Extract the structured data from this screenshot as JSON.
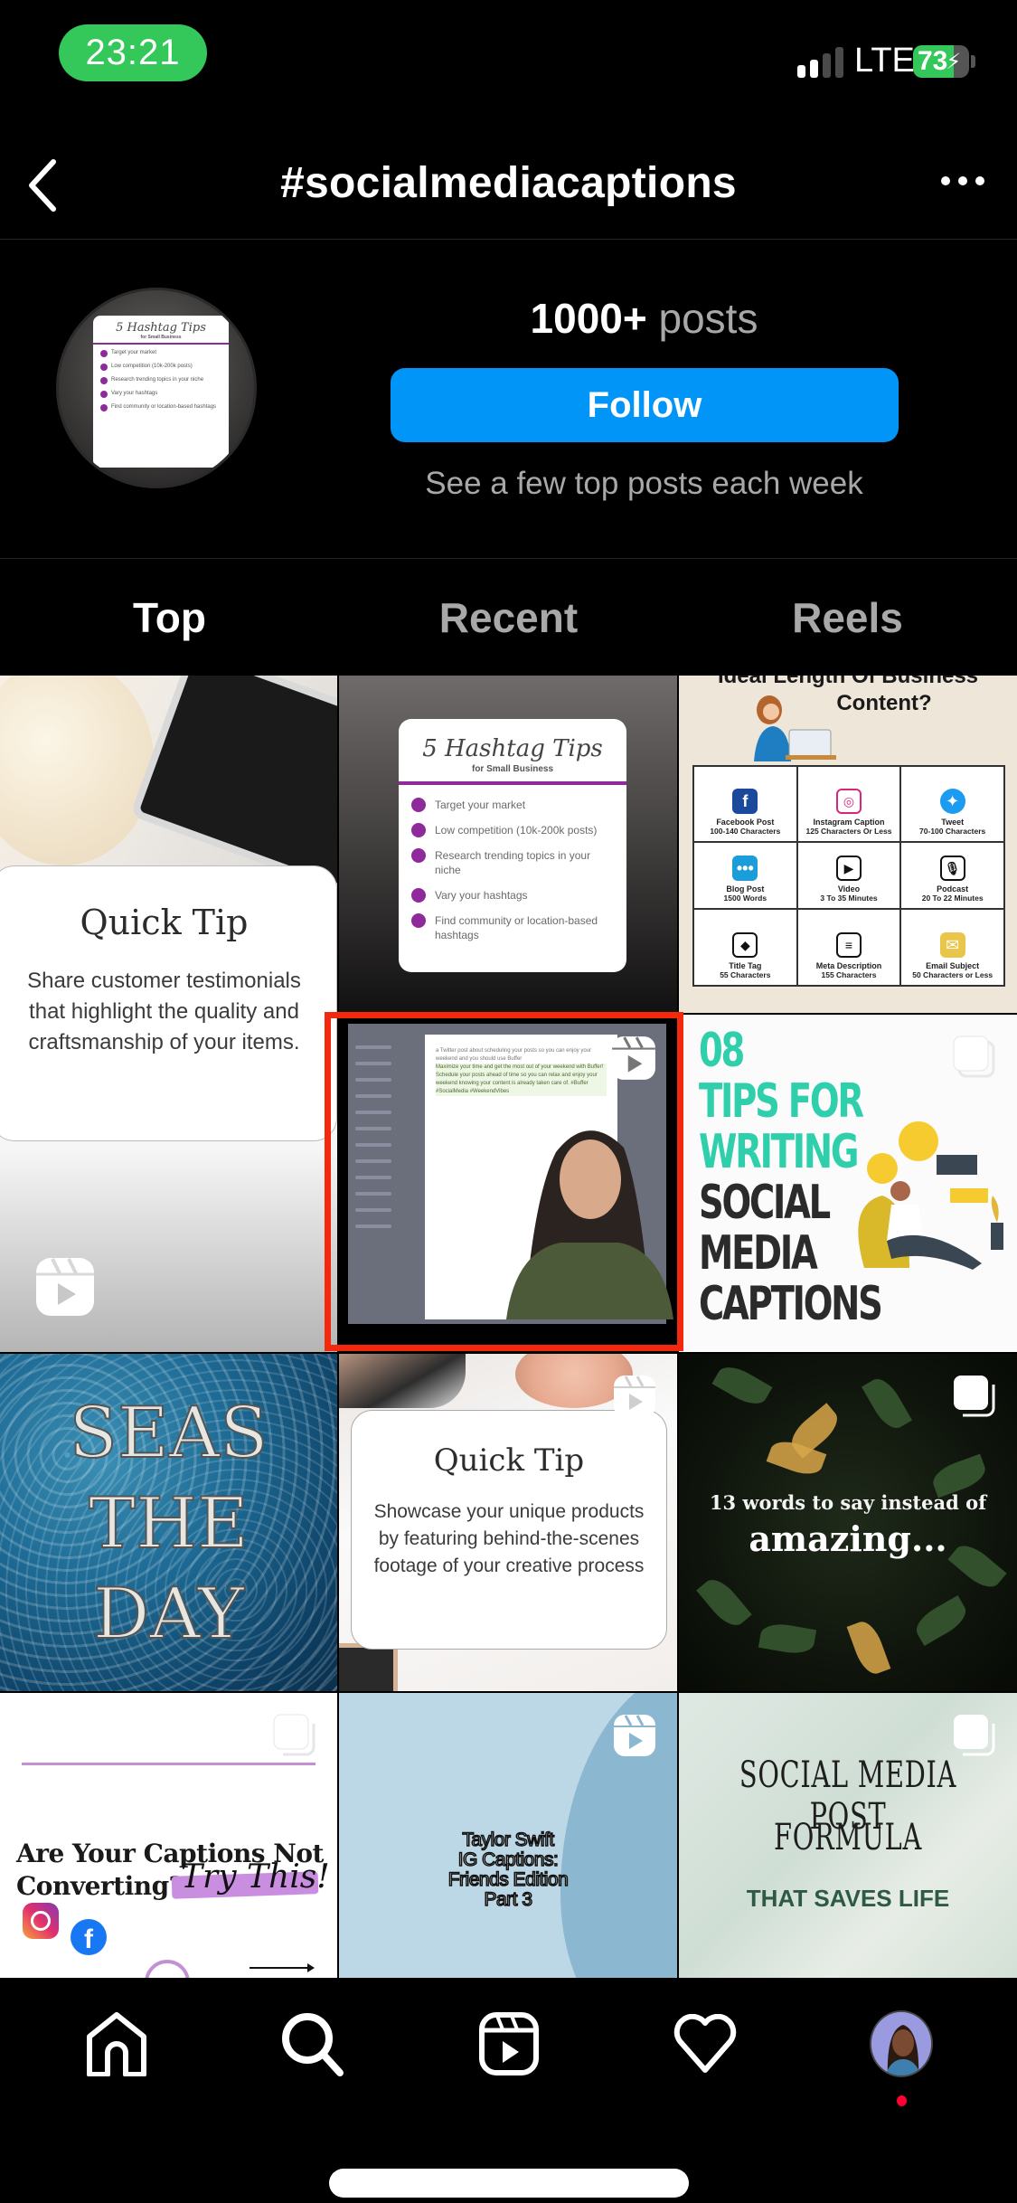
{
  "status_bar": {
    "time": "23:21",
    "network": "LTE",
    "battery_level": "73",
    "battery_percent": 73,
    "charging": true,
    "signal_bars_active": 2,
    "signal_bars_total": 4
  },
  "header": {
    "title": "#socialmediacaptions",
    "back_icon": "chevron-left-icon",
    "more_icon": "ellipsis-icon"
  },
  "hashtag_info": {
    "post_count": "1000+",
    "post_count_label": "posts",
    "follow_label": "Follow",
    "follow_subtitle": "See a few top posts each week",
    "avatar_card": {
      "title": "5 Hashtag Tips",
      "subtitle": "for Small Business",
      "items": [
        "Target your market",
        "Low competition (10k-200k posts)",
        "Research trending topics in your niche",
        "Vary your hashtags",
        "Find community or location-based hashtags"
      ]
    }
  },
  "tabs": [
    {
      "label": "Top",
      "active": true
    },
    {
      "label": "Recent",
      "active": false
    },
    {
      "label": "Reels",
      "active": false
    }
  ],
  "grid": {
    "quick_tip_1": {
      "type": "reel",
      "title": "Quick Tip",
      "body": "Share customer testimonials that highlight the quality and craftsmanship of your items."
    },
    "hashtag_tips": {
      "type": "post",
      "title": "5 Hashtag Tips",
      "subtitle": "for Small Business",
      "items": [
        "Target your market",
        "Low competition (10k-200k posts)",
        "Research trending topics in your niche",
        "Vary your hashtags",
        "Find community or location-based hashtags"
      ]
    },
    "ideal_length": {
      "type": "post",
      "title_line1": "Ideal Length Of Business",
      "title_line2": "Content?",
      "cells": [
        {
          "name": "Facebook Post",
          "value": "100-140 Characters",
          "icon": "facebook-icon",
          "color": "#1b4a9c"
        },
        {
          "name": "Instagram Caption",
          "value": "125 Characters Or Less",
          "icon": "instagram-icon",
          "color": "#d6287a"
        },
        {
          "name": "Tweet",
          "value": "70-100 Characters",
          "icon": "twitter-icon",
          "color": "#1d9bf0"
        },
        {
          "name": "Blog Post",
          "value": "1500 Words",
          "icon": "chat-bubbles-icon",
          "color": "#1b9dd9"
        },
        {
          "name": "Video",
          "value": "3 To 35 Minutes",
          "icon": "video-reel-icon",
          "color": "#111111"
        },
        {
          "name": "Podcast",
          "value": "20 To 22 Minutes",
          "icon": "podcast-mic-icon",
          "color": "#111111"
        },
        {
          "name": "Title Tag",
          "value": "55 Characters",
          "icon": "tag-icon",
          "color": "#111111"
        },
        {
          "name": "Meta Description",
          "value": "155 Characters",
          "icon": "message-icon",
          "color": "#111111"
        },
        {
          "name": "Email  Subject",
          "value": "50 Characters or Less",
          "icon": "envelope-icon",
          "color": "#e9c54a"
        }
      ]
    },
    "buffer_video": {
      "type": "reel",
      "highlighted": true,
      "modal_text_1": "a Twitter post about scheduling your posts so you can enjoy your weekend and you should use Buffer",
      "modal_text_2": "Maximize your time and get the most out of your weekend with Buffer! Schedule your posts ahead of time so you can relax and enjoy your weekend knowing your content is already taken care of. #Buffer #SocialMedia #WeekendVibes"
    },
    "tips_08": {
      "type": "carousel",
      "line1": "08",
      "line2": "TIPS FOR",
      "line3": "WRITING",
      "line4": "SOCIAL",
      "line5": "MEDIA",
      "line6": "CAPTIONS",
      "accent": "#2fcfab"
    },
    "seas": {
      "type": "post",
      "line1": "SEAS",
      "line2": "THE",
      "line3": "DAY"
    },
    "quick_tip_2": {
      "type": "reel",
      "title": "Quick Tip",
      "body": "Showcase your unique products by featuring behind-the-scenes footage of your creative process"
    },
    "words_13": {
      "type": "carousel",
      "line1": "13 words to say instead of",
      "line2": "amazing..."
    },
    "captions_converting": {
      "type": "carousel",
      "line1": "Are Your Captions Not",
      "line2": "Converting?",
      "script": "Try This!"
    },
    "taylor_swift": {
      "type": "reel",
      "line1": "Taylor Swift",
      "line2": "IG Captions:",
      "line3": "Friends Edition",
      "line4": "Part 3"
    },
    "post_formula": {
      "type": "carousel",
      "line1": "SOCIAL MEDIA POST",
      "line2": "FORMULA",
      "line3": "THAT SAVES LIFE"
    }
  },
  "bottom_nav": {
    "items": [
      {
        "name": "home",
        "icon": "home-icon"
      },
      {
        "name": "search",
        "icon": "search-icon",
        "active": true
      },
      {
        "name": "reels",
        "icon": "reels-icon"
      },
      {
        "name": "activity",
        "icon": "heart-icon"
      },
      {
        "name": "profile",
        "icon": "profile-avatar",
        "has_notification": true
      }
    ]
  },
  "colors": {
    "follow_button": "#0095f6",
    "time_pill": "#34c759",
    "highlight_box": "#f2290c",
    "notification_dot": "#ff0033",
    "secondary_text": "#a8a8a8"
  }
}
